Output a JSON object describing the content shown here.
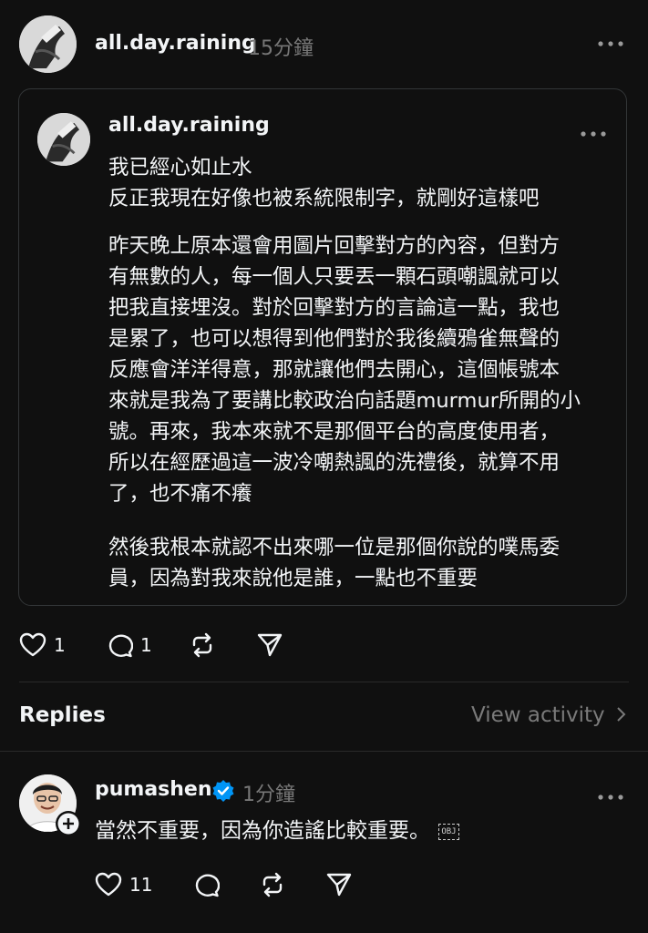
{
  "post": {
    "username": "all.day.raining",
    "time": "15分鐘"
  },
  "quote": {
    "username": "all.day.raining",
    "paragraphs": [
      [
        "我已經心如止水",
        "反正我現在好像也被系統限制字，就剛好這樣吧"
      ],
      [
        "昨天晚上原本還會用圖片回擊對方的內容，但對方",
        "有無數的人，每一個人只要丟一顆石頭嘲諷就可以",
        "把我直接埋沒。對於回擊對方的言論這一點，我也",
        "是累了，也可以想得到他們對於我後續鴉雀無聲的",
        "反應會洋洋得意，那就讓他們去開心，這個帳號本",
        "來就是我為了要講比較政治向話題murmur所開的小",
        "號。再來，我本來就不是那個平台的高度使用者，",
        "所以在經歷過這一波冷嘲熱諷的洗禮後，就算不用",
        "了，也不痛不癢"
      ],
      [
        "然後我根本就認不出來哪一位是那個你說的噗馬委",
        "員，因為對我來說他是誰，一點也不重要"
      ]
    ]
  },
  "post_actions": {
    "likes": "1",
    "comments": "1"
  },
  "replies_header": {
    "title": "Replies",
    "view_activity": "View activity"
  },
  "reply": {
    "username": "pumashen",
    "time": "1分鐘",
    "text": "當然不重要，因為你造謠比較重要。",
    "obj_marker": "OBJ",
    "likes": "11"
  },
  "colors": {
    "background": "#101010",
    "text": "#f3f5f7",
    "secondary": "#777777",
    "verified": "#0095f6"
  }
}
